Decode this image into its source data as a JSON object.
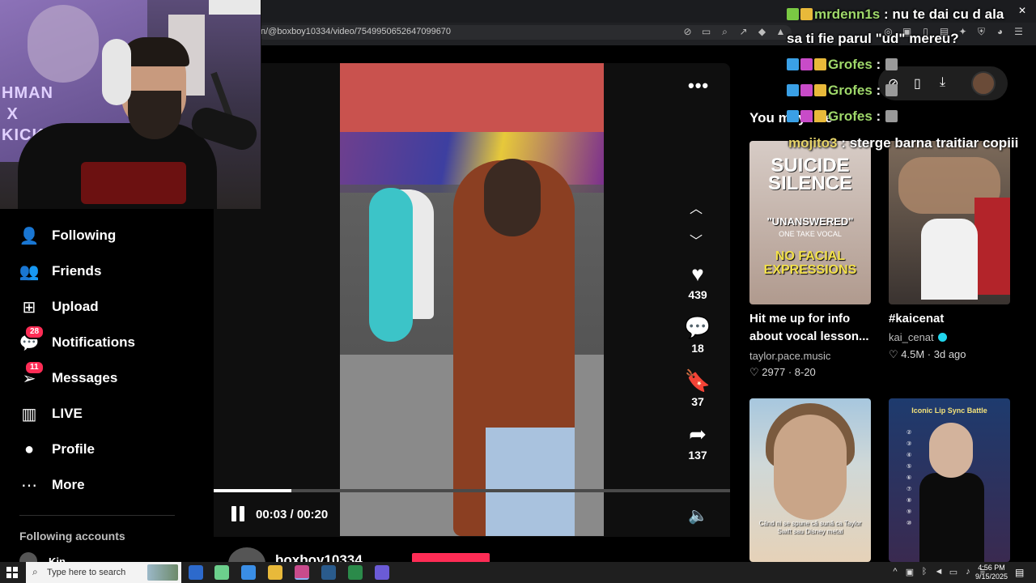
{
  "browser": {
    "url": "n/@boxboy10334/video/7549950652647099670"
  },
  "sidebar": {
    "items": [
      {
        "label": "Following",
        "icon": "following-icon",
        "badge": ""
      },
      {
        "label": "Friends",
        "icon": "friends-icon",
        "badge": ""
      },
      {
        "label": "Upload",
        "icon": "upload-icon",
        "badge": ""
      },
      {
        "label": "Notifications",
        "icon": "notifications-icon",
        "badge": "28"
      },
      {
        "label": "Messages",
        "icon": "messages-icon",
        "badge": "11"
      },
      {
        "label": "LIVE",
        "icon": "live-icon",
        "badge": ""
      },
      {
        "label": "Profile",
        "icon": "profile-icon",
        "badge": ""
      },
      {
        "label": "More",
        "icon": "more-icon",
        "badge": ""
      }
    ],
    "following_header": "Following accounts",
    "account_name": "Kin"
  },
  "webcam": {
    "poster_text": "HMAN\n X\nKICK"
  },
  "video": {
    "time": "00:03 / 00:20",
    "progress": 0.15,
    "likes": "439",
    "comments": "18",
    "saves": "37",
    "shares": "137",
    "author": "boxboy10334"
  },
  "recommended": {
    "header": "You may like",
    "cards": [
      {
        "thumb_title": "SUICIDE SILENCE",
        "thumb_sub1": "\"UNANSWERED\"",
        "thumb_sub2": "ONE TAKE VOCAL",
        "thumb_sub3": "NO FACIAL EXPRESSIONS",
        "title": "Hit me up for info about vocal lesson...",
        "author": "taylor.pace.music",
        "verified": false,
        "likes": "2977",
        "date": "8-20"
      },
      {
        "title": "#kaicenat",
        "author": "kai_cenat",
        "verified": true,
        "likes": "4.5M",
        "date": "3d ago"
      },
      {
        "thumb_caption": "Când ni se spune că sună ca Taylor Swift sau Disney metal"
      },
      {
        "thumb_title": "Iconic Lip Sync Battle"
      }
    ]
  },
  "chat": [
    {
      "user": "mrdenn1s",
      "text": ": nu te dai cu d ala"
    },
    {
      "user": "",
      "text": "sa ti fie parul \"ud\" mereu?"
    },
    {
      "user": "Grofes",
      "text": ":"
    },
    {
      "user": "Grofes",
      "text": ":"
    },
    {
      "user": "Grofes",
      "text": ":"
    },
    {
      "user": "mojito3",
      "text": ": sterge barna traitiar copiii"
    }
  ],
  "taskbar": {
    "search_placeholder": "Type here to search",
    "time": "4:56 PM",
    "date": "9/15/2025"
  },
  "colors": {
    "accent": "#fe2c55",
    "verified": "#20d5ec",
    "chat_user_green": "#9fd86a"
  }
}
